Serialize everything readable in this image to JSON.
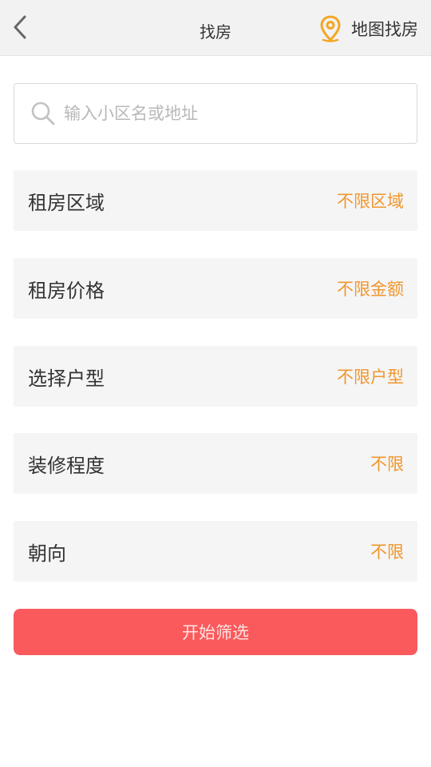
{
  "header": {
    "title": "找房",
    "map_label": "地图找房",
    "accent_color": "#f5a623"
  },
  "search": {
    "placeholder": "输入小区名或地址",
    "value": ""
  },
  "filters": [
    {
      "label": "租房区域",
      "value": "不限区域"
    },
    {
      "label": "租房价格",
      "value": "不限金额"
    },
    {
      "label": "选择户型",
      "value": "不限户型"
    },
    {
      "label": "装修程度",
      "value": "不限"
    },
    {
      "label": "朝向",
      "value": "不限"
    }
  ],
  "submit": {
    "label": "开始筛选",
    "color": "#fa5a5c"
  }
}
